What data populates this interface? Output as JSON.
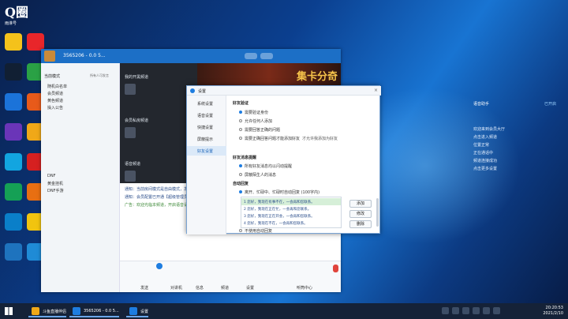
{
  "desktop": {
    "logo_text": "Q圈",
    "logo_sub": "雨淋号",
    "icon_colors": [
      "#f4c21b",
      "#e8262a",
      "#111f33",
      "#2aa145",
      "#1b73d9",
      "#e85a1a",
      "#6a35b8",
      "#f0a818",
      "#12a5e0",
      "#d62020",
      "#15a055",
      "#e86f12",
      "#0a7fc9",
      "#f1c40f",
      "#1e73be",
      "#1f8bd6"
    ]
  },
  "qq": {
    "title": "3565206 - 0.0 5...",
    "left_header": "当前模式",
    "left_header_right": "所有人可发言",
    "left_items": [
      "随机白名单",
      "会员频道",
      "黄色频道",
      "操入公告",
      "DNF",
      "黄金挂机",
      "DNF手游"
    ],
    "mid_sections": [
      "我的开黑频道",
      "会员私房频道",
      "语音频道"
    ],
    "banner_text": "集卡分奇",
    "chat_lines": [
      "通知：当前房间模式是自由模式，发言无需排麦",
      "通知：会员配置已开通【超级管理员】，您还可…",
      "广告：欢迎光临本频道，开启语音请点击左下角..."
    ],
    "input_left": "发送",
    "input_right": "听筒中心",
    "bottom_icons": [
      "对讲机",
      "信息",
      "频道",
      "设置"
    ]
  },
  "side_panel": {
    "title": "语音助手",
    "status": "已开启",
    "lines": [
      "欢迎来到会员大厅",
      "点击进入频道",
      "位置正常",
      "正在通话中",
      "频道连接成功",
      "点击更多设置"
    ]
  },
  "dialog": {
    "title": "设置",
    "close": "×",
    "nav": [
      "系统设置",
      "语音设置",
      "快捷设置",
      "屏蔽提示",
      "好友设置"
    ],
    "nav_selected": 4,
    "sections": [
      "好友验证",
      "好友消息提醒",
      "自动回复"
    ],
    "verify_options": [
      "需要验证身份",
      "允许任何人添加",
      "需要回答正确的问题",
      "需要正确回答问题才能添加好友"
    ],
    "verify_selected": 0,
    "verify_extra": "才允许我添加为好友",
    "message_options": [
      "所有好友消息均以闪动提醒",
      "屏蔽陌生人的消息"
    ],
    "message_selected": 0,
    "auto_reply_options": [
      "离开、忙碌中、忙碌时自动回复 (100字内)",
      "不使用自动回复"
    ],
    "auto_reply_selected": 0,
    "reply_list": [
      "1  您好，我现在有事不在，一会再和您联系。",
      "2  您好，我现在正在忙，一会再和您联系。",
      "3  您好，我现在正在开会，一会再和您联系。",
      "4  您好，我现在不在，一会再和您联系。"
    ],
    "reply_selected": 0,
    "buttons": [
      "添加",
      "修改",
      "删除"
    ]
  },
  "taskbar": {
    "items": [
      "斗鱼直播伴侣",
      "3565206 - 0.0 5...",
      "设置"
    ],
    "time": "20:20:53",
    "date": "2021/2/10"
  }
}
